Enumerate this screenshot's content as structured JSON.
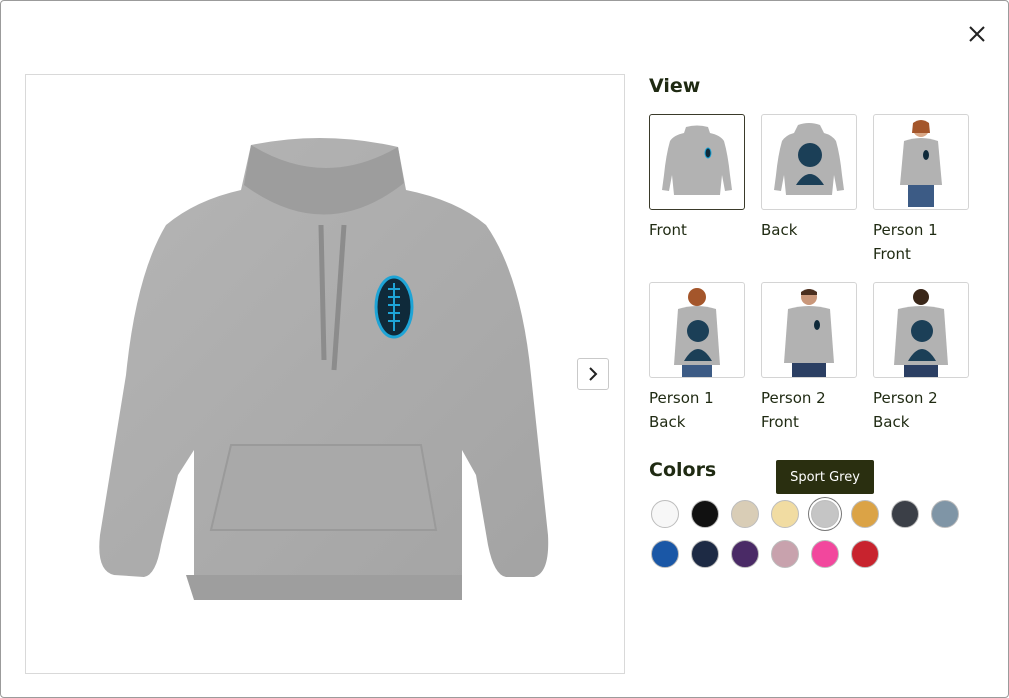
{
  "view": {
    "title": "View",
    "thumbnails": [
      {
        "label": "Front",
        "selected": true
      },
      {
        "label": "Back",
        "selected": false
      },
      {
        "label": "Person 1\nFront",
        "selected": false
      },
      {
        "label": "Person 1\nBack",
        "selected": false
      },
      {
        "label": "Person 2\nFront",
        "selected": false
      },
      {
        "label": "Person 2\nBack",
        "selected": false
      }
    ]
  },
  "colors": {
    "title": "Colors",
    "tooltip": "Sport Grey",
    "swatches": [
      {
        "hex": "#f7f7f7",
        "selected": false
      },
      {
        "hex": "#111111",
        "selected": false
      },
      {
        "hex": "#d9cdb6",
        "selected": false
      },
      {
        "hex": "#f1dca2",
        "selected": false
      },
      {
        "hex": "#c5c5c5",
        "selected": true
      },
      {
        "hex": "#dba346",
        "selected": false
      },
      {
        "hex": "#3b3f47",
        "selected": false
      },
      {
        "hex": "#7f95a6",
        "selected": false
      },
      {
        "hex": "#1a57a6",
        "selected": false
      },
      {
        "hex": "#1d2a44",
        "selected": false
      },
      {
        "hex": "#4a2a66",
        "selected": false
      },
      {
        "hex": "#c8a2ad",
        "selected": false
      },
      {
        "hex": "#f2479d",
        "selected": false
      },
      {
        "hex": "#c8232e",
        "selected": false
      }
    ]
  },
  "icons": {
    "close": "close-icon",
    "next": "chevron-right-icon"
  }
}
